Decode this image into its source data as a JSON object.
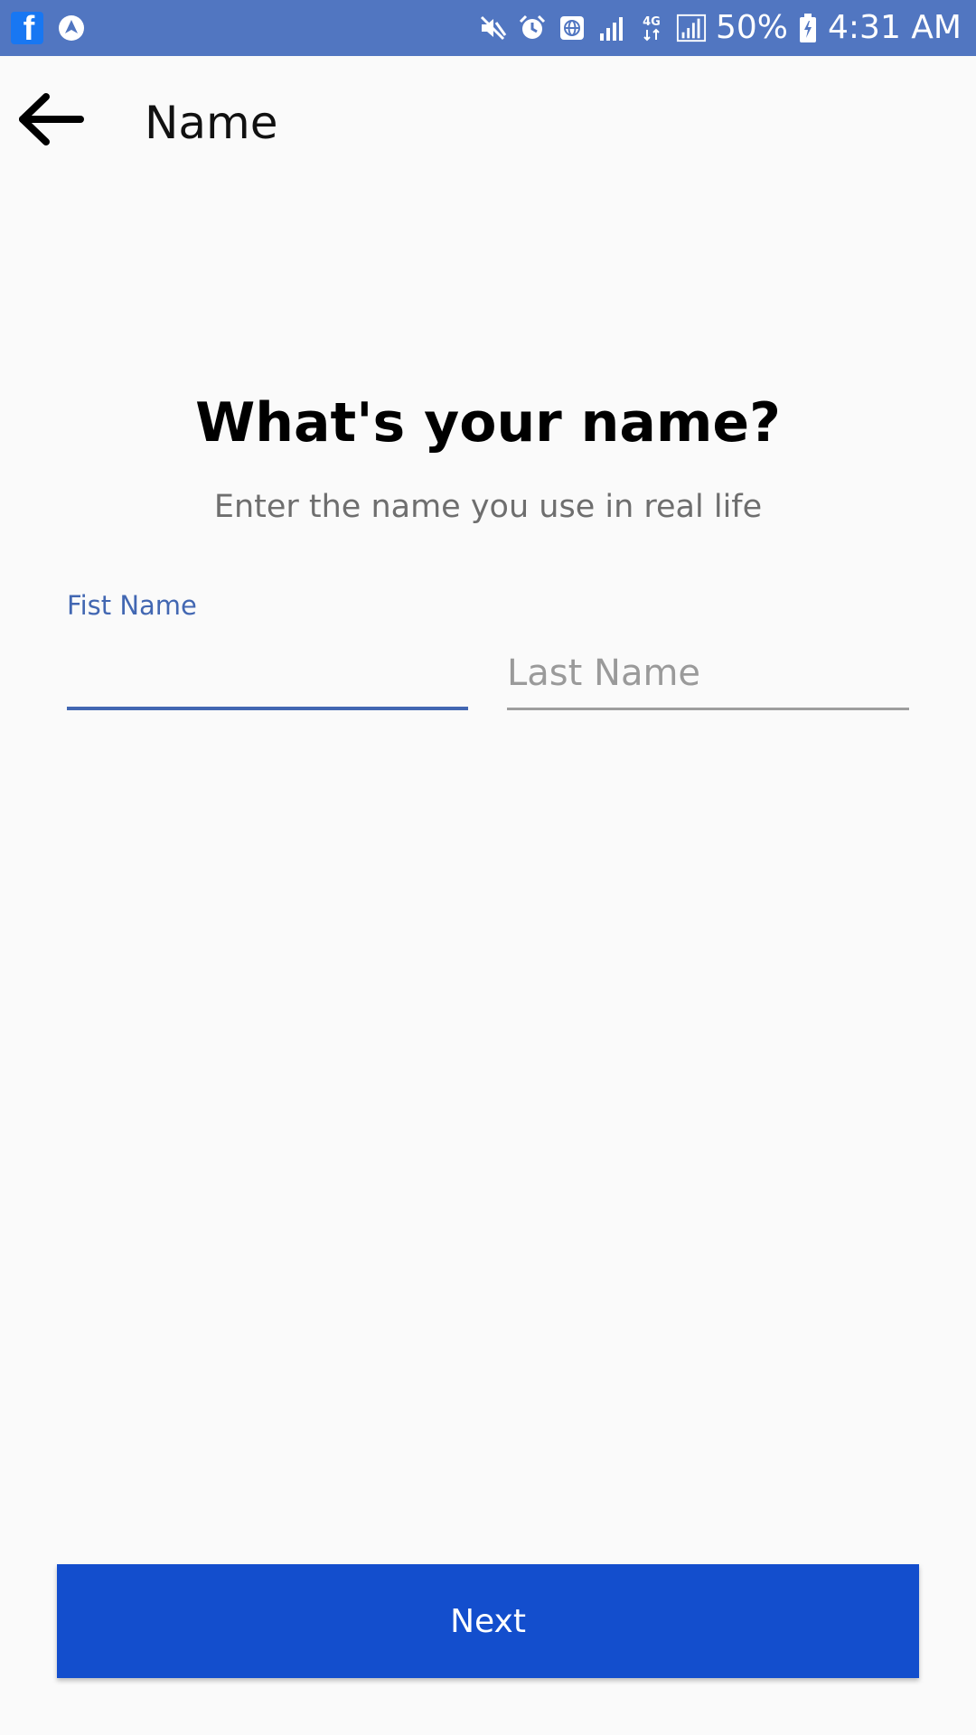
{
  "status_bar": {
    "left_icons": [
      "facebook-icon",
      "navigation-icon"
    ],
    "right_icons": [
      "mute-icon",
      "alarm-icon",
      "globe-icon",
      "signal-icon",
      "4g-icon",
      "signal-full-icon",
      "battery-icon"
    ],
    "network_label": "4G",
    "battery_percent": "50%",
    "time": "4:31 AM",
    "background_color": "#5176c1"
  },
  "app_bar": {
    "back_icon": "arrow-left-icon",
    "title": "Name"
  },
  "main": {
    "heading": "What's your name?",
    "subheading": "Enter the name you use in real life",
    "first_name": {
      "label": "Fist Name",
      "value": "",
      "accent_color": "#4267b2"
    },
    "last_name": {
      "placeholder": "Last Name",
      "value": ""
    }
  },
  "footer": {
    "next_label": "Next",
    "button_color": "#134ecd"
  }
}
